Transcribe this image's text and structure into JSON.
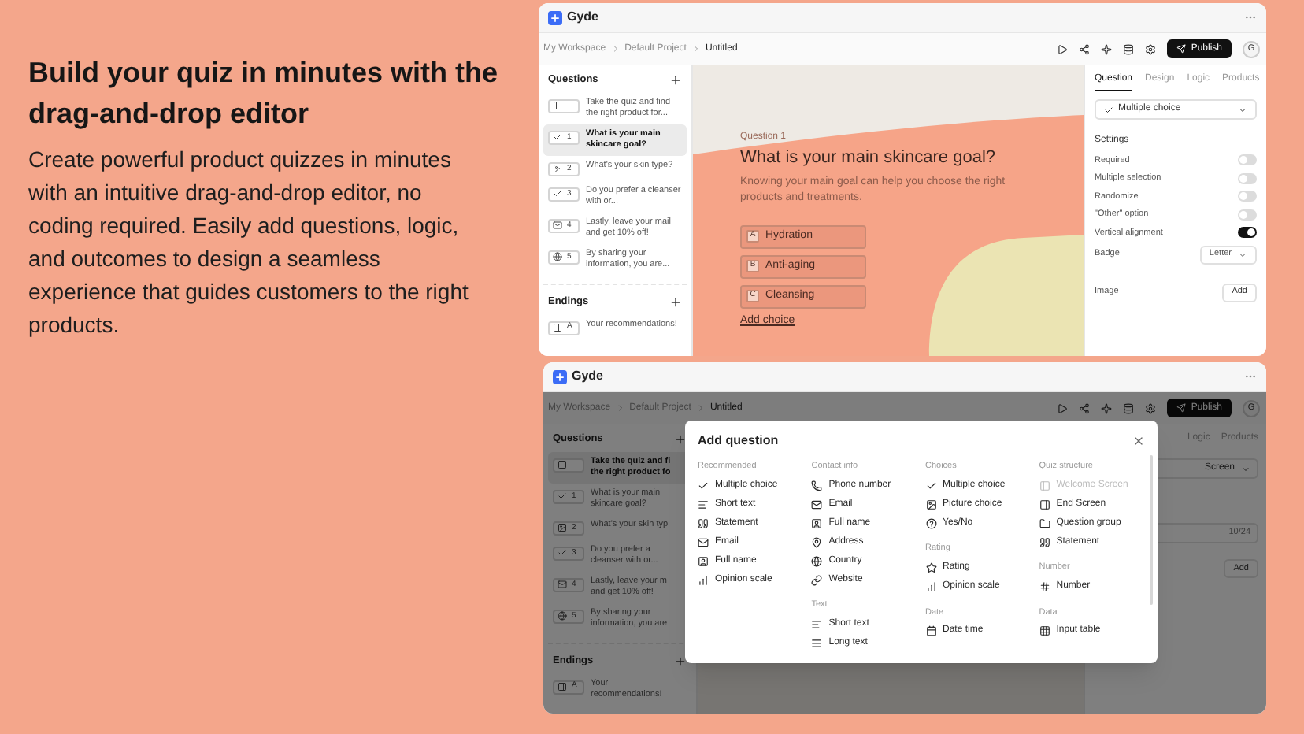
{
  "intro": {
    "title": "Build your quiz in minutes with the drag-and-drop editor",
    "body": "Create powerful product quizzes in minutes with an intuitive drag-and-drop editor, no coding required. Easily add questions, logic, and outcomes to design a seamless experience that guides customers to the right products."
  },
  "editor": {
    "app_name": "Gyde",
    "breadcrumbs": [
      {
        "label": "My Workspace",
        "current": false
      },
      {
        "label": "Default Project",
        "current": false
      },
      {
        "label": "Untitled",
        "current": true
      }
    ],
    "publish": "Publish",
    "avatar": "G",
    "questions_heading": "Questions",
    "questions": [
      {
        "kind": "welcome",
        "text": "Take the quiz and find the right product for...",
        "selected": false
      },
      {
        "kind": "multiple_choice",
        "number": "1",
        "text": "What is your main skincare goal?",
        "selected": true
      },
      {
        "kind": "picture_choice",
        "number": "2",
        "text": "What's your skin type?",
        "selected": false
      },
      {
        "kind": "multiple_choice",
        "number": "3",
        "text": "Do you prefer a cleanser with or...",
        "selected": false
      },
      {
        "kind": "email",
        "number": "4",
        "text": "Lastly, leave your mail and get 10% off!",
        "selected": false
      },
      {
        "kind": "country",
        "number": "5",
        "text": "By sharing your information, you are...",
        "selected": false
      }
    ],
    "endings_heading": "Endings",
    "endings": [
      {
        "kind": "ending",
        "number": "A",
        "text": "Your recommendations!",
        "selected": false
      }
    ],
    "canvas": {
      "label": "Question 1",
      "title": "What is your main skincare goal?",
      "description": "Knowing your main goal can help you choose the right products and treatments.",
      "choices": [
        {
          "badge": "A",
          "text": "Hydration"
        },
        {
          "badge": "B",
          "text": "Anti-aging"
        },
        {
          "badge": "C",
          "text": "Cleansing"
        }
      ],
      "add_choice": "Add choice"
    },
    "panel": {
      "tabs": [
        {
          "label": "Question",
          "selected": true
        },
        {
          "label": "Design",
          "selected": false
        },
        {
          "label": "Logic",
          "selected": false
        },
        {
          "label": "Products",
          "selected": false
        }
      ],
      "type_select": "Multiple choice",
      "settings_heading": "Settings",
      "toggles": [
        {
          "label": "Required",
          "on": false
        },
        {
          "label": "Multiple selection",
          "on": false
        },
        {
          "label": "Randomize",
          "on": false
        },
        {
          "label": "\"Other\" option",
          "on": false
        },
        {
          "label": "Vertical alignment",
          "on": true
        }
      ],
      "badge_label": "Badge",
      "badge_value": "Letter",
      "image_label": "Image",
      "image_button": "Add"
    }
  },
  "editor_behind": {
    "app_name": "Gyde",
    "breadcrumbs": [
      {
        "label": "My Workspace",
        "current": false
      },
      {
        "label": "Default Project",
        "current": false
      },
      {
        "label": "Untitled",
        "current": true
      }
    ],
    "publish": "Publish",
    "avatar": "G",
    "questions_heading": "Questions",
    "questions": [
      {
        "kind": "welcome",
        "lines": [
          "Take the quiz and fi",
          "the right product fo"
        ],
        "selected": true
      },
      {
        "kind": "multiple_choice",
        "number": "1",
        "lines": [
          "What is your main",
          "skincare goal?"
        ],
        "selected": false
      },
      {
        "kind": "picture_choice",
        "number": "2",
        "lines": [
          "What's your skin typ"
        ],
        "selected": false
      },
      {
        "kind": "multiple_choice",
        "number": "3",
        "lines": [
          "Do you prefer a",
          "cleanser with or..."
        ],
        "selected": false
      },
      {
        "kind": "email",
        "number": "4",
        "lines": [
          "Lastly, leave your m",
          "and get 10% off!"
        ],
        "selected": false
      },
      {
        "kind": "country",
        "number": "5",
        "lines": [
          "By sharing your",
          "information, you are"
        ],
        "selected": false
      }
    ],
    "endings_heading": "Endings",
    "endings": [
      {
        "kind": "ending",
        "number": "A",
        "lines": [
          "Your",
          "recommendations!"
        ],
        "selected": false
      }
    ],
    "panel": {
      "tabs": [
        {
          "label": "Logic",
          "selected": false
        },
        {
          "label": "Products",
          "selected": false
        }
      ],
      "type_select": "Screen",
      "field_value": "10/24",
      "image_button": "Add"
    }
  },
  "dialog": {
    "title": "Add question",
    "columns": [
      {
        "groups": [
          {
            "heading": "Recommended",
            "options": [
              {
                "kind": "multiple_choice",
                "label": "Multiple choice",
                "disabled": false
              },
              {
                "kind": "short_text",
                "label": "Short text",
                "disabled": false
              },
              {
                "kind": "statement",
                "label": "Statement",
                "disabled": false
              },
              {
                "kind": "email",
                "label": "Email",
                "disabled": false
              },
              {
                "kind": "full_name",
                "label": "Full name",
                "disabled": false
              },
              {
                "kind": "opinion_scale",
                "label": "Opinion scale",
                "disabled": false
              }
            ]
          }
        ]
      },
      {
        "groups": [
          {
            "heading": "Contact info",
            "options": [
              {
                "kind": "phone",
                "label": "Phone number",
                "disabled": false
              },
              {
                "kind": "email",
                "label": "Email",
                "disabled": false
              },
              {
                "kind": "full_name",
                "label": "Full name",
                "disabled": false
              },
              {
                "kind": "address",
                "label": "Address",
                "disabled": false
              },
              {
                "kind": "country",
                "label": "Country",
                "disabled": false
              },
              {
                "kind": "website",
                "label": "Website",
                "disabled": false
              }
            ]
          },
          {
            "heading": "Text",
            "options": [
              {
                "kind": "short_text",
                "label": "Short text",
                "disabled": false
              },
              {
                "kind": "long_text",
                "label": "Long text",
                "disabled": false
              }
            ]
          }
        ]
      },
      {
        "groups": [
          {
            "heading": "Choices",
            "options": [
              {
                "kind": "multiple_choice",
                "label": "Multiple choice",
                "disabled": false
              },
              {
                "kind": "picture_choice",
                "label": "Picture choice",
                "disabled": false
              },
              {
                "kind": "yes_no",
                "label": "Yes/No",
                "disabled": false
              }
            ]
          },
          {
            "heading": "Rating",
            "options": [
              {
                "kind": "rating",
                "label": "Rating",
                "disabled": false
              },
              {
                "kind": "opinion_scale",
                "label": "Opinion scale",
                "disabled": false
              }
            ]
          },
          {
            "heading": "Date",
            "options": [
              {
                "kind": "date_time",
                "label": "Date time",
                "disabled": false
              }
            ]
          }
        ]
      },
      {
        "groups": [
          {
            "heading": "Quiz structure",
            "options": [
              {
                "kind": "welcome",
                "label": "Welcome Screen",
                "disabled": true
              },
              {
                "kind": "ending",
                "label": "End Screen",
                "disabled": false
              },
              {
                "kind": "group",
                "label": "Question group",
                "disabled": false
              },
              {
                "kind": "statement",
                "label": "Statement",
                "disabled": false
              }
            ]
          },
          {
            "heading": "Number",
            "options": [
              {
                "kind": "number",
                "label": "Number",
                "disabled": false
              }
            ]
          },
          {
            "heading": "Data",
            "options": [
              {
                "kind": "table",
                "label": "Input table",
                "disabled": false
              }
            ]
          }
        ]
      }
    ]
  }
}
